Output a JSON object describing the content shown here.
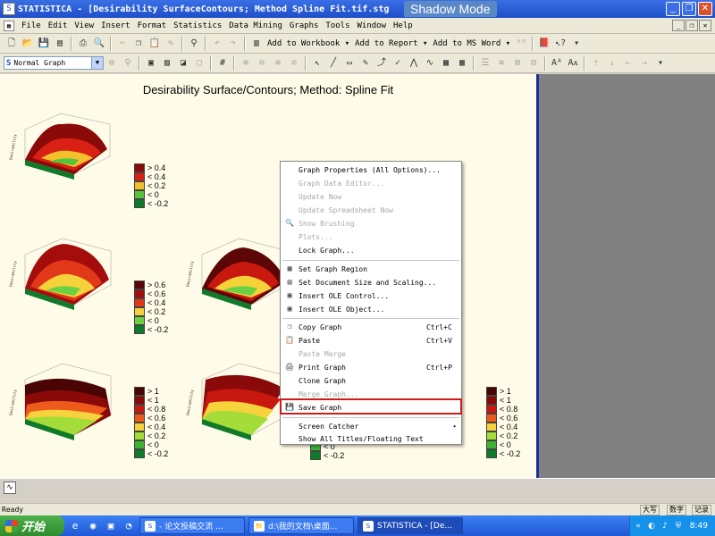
{
  "window": {
    "title": "STATISTICA - [Desirability SurfaceContours; Method Spline Fit.tif.stg",
    "overlay_badge": "Shadow Mode",
    "buttons": [
      "_",
      "❐",
      "✕"
    ]
  },
  "menubar": {
    "items": [
      "File",
      "Edit",
      "View",
      "Insert",
      "Format",
      "Statistics",
      "Data Mining",
      "Graphs",
      "Tools",
      "Window",
      "Help"
    ],
    "mdi_buttons": [
      "_",
      "❐",
      "✕"
    ]
  },
  "toolbar1": {
    "add_to_workbook": "Add to Workbook ▾",
    "add_to_report": "Add to Report ▾",
    "add_to_ms_word": "Add to MS Word ▾"
  },
  "toolbar2": {
    "graph_type_value": "Normal Graph",
    "graph_type_icon_letter": "S"
  },
  "graph": {
    "title": "Desirability Surface/Contours; Method: Spline Fit",
    "legend_small": [
      {
        "label": "> 0.4",
        "color": "#8a0a0a"
      },
      {
        "label": "< 0.4",
        "color": "#d92014"
      },
      {
        "label": "< 0.2",
        "color": "#f2c02c"
      },
      {
        "label": "< 0",
        "color": "#55c43a"
      },
      {
        "label": "< -0.2",
        "color": "#0f7a2a"
      }
    ],
    "legend_medium": [
      {
        "label": "> 0.6",
        "color": "#5c0606"
      },
      {
        "label": "< 0.6",
        "color": "#a50d0d"
      },
      {
        "label": "< 0.4",
        "color": "#e2381a"
      },
      {
        "label": "< 0.2",
        "color": "#f5d23a"
      },
      {
        "label": "< 0",
        "color": "#6cd044"
      },
      {
        "label": "< -0.2",
        "color": "#0f7a2a"
      }
    ],
    "legend_large": [
      {
        "label": "> 1",
        "color": "#4a0404"
      },
      {
        "label": "< 1",
        "color": "#8a0a0a"
      },
      {
        "label": "< 0.8",
        "color": "#c8180f"
      },
      {
        "label": "< 0.6",
        "color": "#ee5a1c"
      },
      {
        "label": "< 0.4",
        "color": "#f6d23c"
      },
      {
        "label": "< 0.2",
        "color": "#a4dc3a"
      },
      {
        "label": "< 0",
        "color": "#3cb334"
      },
      {
        "label": "< -0.2",
        "color": "#0f7a2a"
      }
    ],
    "partial_legend_bottom": [
      "< 0",
      "< -0.2"
    ]
  },
  "context_menu": {
    "items": [
      {
        "label": "Graph Properties (All Options)...",
        "shortcut": "",
        "disabled": false,
        "icon": ""
      },
      {
        "label": "Graph Data Editor...",
        "shortcut": "",
        "disabled": true,
        "icon": ""
      },
      {
        "label": "Update Now",
        "shortcut": "",
        "disabled": true,
        "icon": ""
      },
      {
        "label": "Update Spreadsheet Now",
        "shortcut": "",
        "disabled": true,
        "icon": ""
      },
      {
        "label": "Show Brushing",
        "shortcut": "",
        "disabled": true,
        "icon": "🔍"
      },
      {
        "label": "Plots...",
        "shortcut": "",
        "disabled": true,
        "icon": ""
      },
      {
        "label": "Lock Graph...",
        "shortcut": "",
        "disabled": false,
        "icon": ""
      },
      {
        "label": "Set Graph Region",
        "shortcut": "",
        "disabled": false,
        "icon": "▦"
      },
      {
        "label": "Set Document Size and Scaling...",
        "shortcut": "",
        "disabled": false,
        "icon": "▤"
      },
      {
        "label": "Insert OLE Control...",
        "shortcut": "",
        "disabled": false,
        "icon": "▣"
      },
      {
        "label": "Insert OLE Object...",
        "shortcut": "",
        "disabled": false,
        "icon": "▣"
      },
      {
        "label": "Copy Graph",
        "shortcut": "Ctrl+C",
        "disabled": false,
        "icon": "❐"
      },
      {
        "label": "Paste",
        "shortcut": "Ctrl+V",
        "disabled": false,
        "icon": "📋"
      },
      {
        "label": "Paste Merge",
        "shortcut": "",
        "disabled": true,
        "icon": ""
      },
      {
        "label": "Print Graph",
        "shortcut": "Ctrl+P",
        "disabled": false,
        "icon": "🖨"
      },
      {
        "label": "Clone Graph",
        "shortcut": "",
        "disabled": false,
        "icon": ""
      },
      {
        "label": "Merge Graph...",
        "shortcut": "",
        "disabled": true,
        "icon": ""
      },
      {
        "label": "Save Graph",
        "shortcut": "",
        "disabled": false,
        "icon": "💾"
      },
      {
        "label": "Screen Catcher",
        "shortcut": "",
        "disabled": false,
        "icon": "",
        "submenu": true
      },
      {
        "label": "Show All Titles/Floating Text",
        "shortcut": "",
        "disabled": false,
        "icon": ""
      }
    ]
  },
  "statusbar": {
    "text": "Ready",
    "indicators": [
      "大写",
      "数字",
      "记录"
    ]
  },
  "taskbar": {
    "start_label": "开始",
    "tasks": [
      {
        "label": "- 论文投稿交流 ...",
        "icon": "S"
      },
      {
        "label": "d:\\我的文档\\桌面...",
        "icon": "📁"
      },
      {
        "label": "STATISTICA - [De...",
        "icon": "S"
      }
    ],
    "clock": "8:49"
  },
  "colors": {
    "title_bar": "#1d4fc8",
    "graph_bg": "#fffbe9",
    "highlight_box": "#d21a1a",
    "taskbar": "#2157d6",
    "start_button": "#2f8b2e"
  }
}
